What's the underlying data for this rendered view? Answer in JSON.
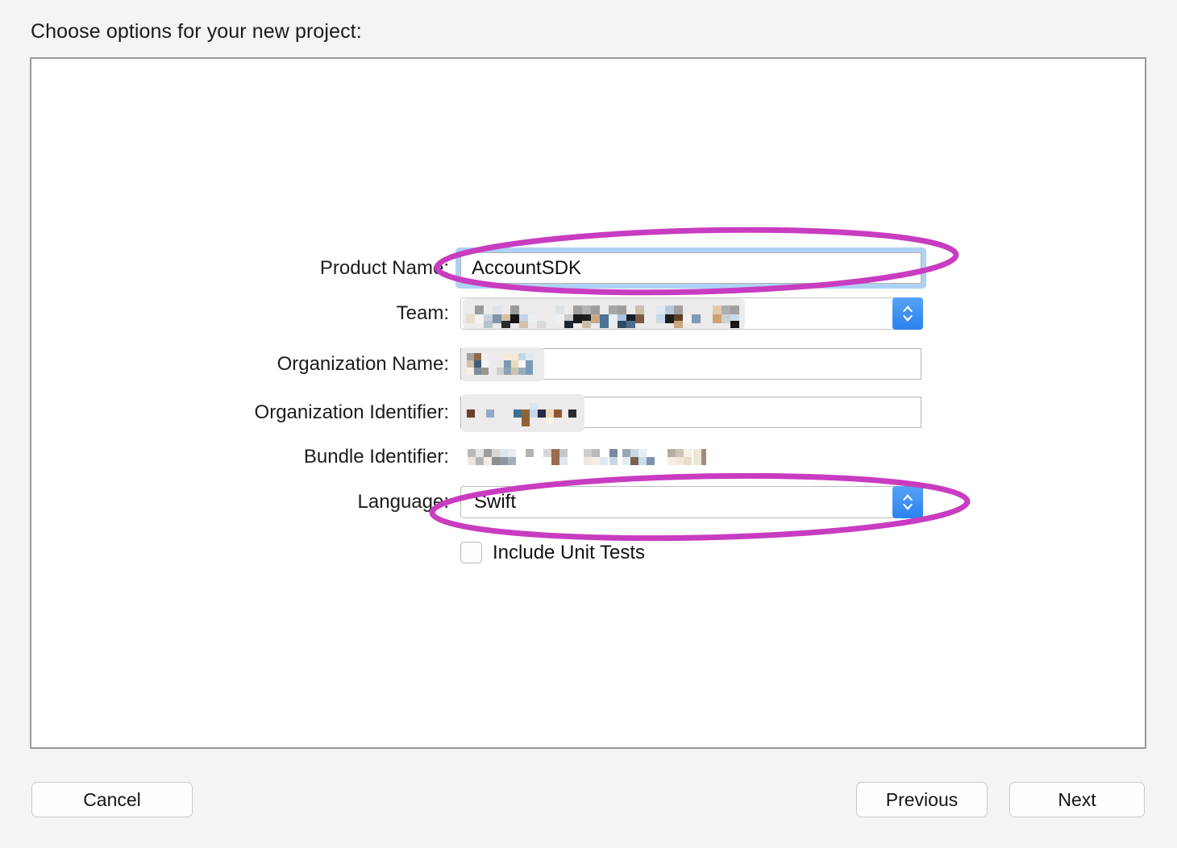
{
  "heading": "Choose options for your new project:",
  "colors": {
    "annotation": "#c83cc0",
    "focus_ring": "#aed2f5",
    "stepper_blue": "#2b82ef",
    "panel_border": "#9a9a9a",
    "page_background": "#f4f4f4"
  },
  "form": {
    "rows": [
      {
        "key": "product_name",
        "label": "Product Name:",
        "type": "text",
        "value": "AccountSDK",
        "focused": true,
        "redacted": false,
        "annotated": true
      },
      {
        "key": "team",
        "label": "Team:",
        "type": "popup",
        "value": "",
        "focused": false,
        "redacted": true,
        "annotated": false
      },
      {
        "key": "organization_name",
        "label": "Organization Name:",
        "type": "text",
        "value": "",
        "focused": false,
        "redacted": true,
        "annotated": false
      },
      {
        "key": "organization_identifier",
        "label": "Organization Identifier:",
        "type": "text",
        "value": "",
        "focused": false,
        "redacted": true,
        "annotated": false
      },
      {
        "key": "bundle_identifier",
        "label": "Bundle Identifier:",
        "type": "static",
        "value": "",
        "focused": false,
        "redacted": true,
        "annotated": false
      },
      {
        "key": "language",
        "label": "Language:",
        "type": "popup",
        "value": "Swift",
        "focused": false,
        "redacted": false,
        "annotated": true
      }
    ],
    "checkbox": {
      "label": "Include Unit Tests",
      "checked": false
    }
  },
  "buttons": {
    "cancel": "Cancel",
    "previous": "Previous",
    "next": "Next"
  },
  "icons": {
    "stepper": "chevron-up-down-icon",
    "checkbox": "checkbox-unchecked-icon",
    "annotation": "ellipse-highlight-icon"
  }
}
